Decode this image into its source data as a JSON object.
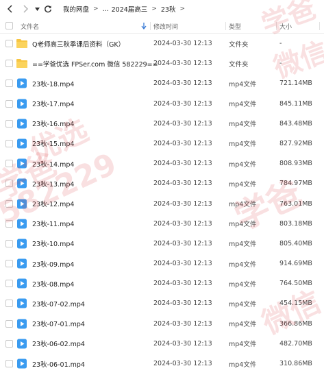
{
  "nav": {
    "breadcrumb": [
      "我的网盘",
      "...",
      "2024届高三",
      "23秋"
    ]
  },
  "header": {
    "name": "文件名",
    "date": "修改时间",
    "type": "类型",
    "size": "大小"
  },
  "files": [
    {
      "icon": "folder-icon",
      "name": "Q老师高三秋季课后资料（GK）",
      "date": "2024-03-30 12:13",
      "type": "文件夹",
      "size": "-"
    },
    {
      "icon": "folder-icon",
      "name": "==学爸优选 FPSer.com 微信 582229==",
      "date": "2024-03-30 12:13",
      "type": "文件夹",
      "size": "-"
    },
    {
      "icon": "video-icon",
      "name": "23秋-18.mp4",
      "date": "2024-03-30 12:13",
      "type": "mp4文件",
      "size": "721.14MB"
    },
    {
      "icon": "video-icon",
      "name": "23秋-17.mp4",
      "date": "2024-03-30 12:13",
      "type": "mp4文件",
      "size": "845.11MB"
    },
    {
      "icon": "video-icon",
      "name": "23秋-16.mp4",
      "date": "2024-03-30 12:13",
      "type": "mp4文件",
      "size": "843.48MB"
    },
    {
      "icon": "video-icon",
      "name": "23秋-15.mp4",
      "date": "2024-03-30 12:13",
      "type": "mp4文件",
      "size": "827.92MB"
    },
    {
      "icon": "video-icon",
      "name": "23秋-14.mp4",
      "date": "2024-03-30 12:13",
      "type": "mp4文件",
      "size": "808.93MB"
    },
    {
      "icon": "video-icon",
      "name": "23秋-13.mp4",
      "date": "2024-03-30 12:13",
      "type": "mp4文件",
      "size": "784.97MB"
    },
    {
      "icon": "video-icon",
      "name": "23秋-12.mp4",
      "date": "2024-03-30 12:13",
      "type": "mp4文件",
      "size": "763.01MB"
    },
    {
      "icon": "video-icon",
      "name": "23秋-11.mp4",
      "date": "2024-03-30 12:13",
      "type": "mp4文件",
      "size": "803.18MB"
    },
    {
      "icon": "video-icon",
      "name": "23秋-10.mp4",
      "date": "2024-03-30 12:13",
      "type": "mp4文件",
      "size": "805.40MB"
    },
    {
      "icon": "video-icon",
      "name": "23秋-09.mp4",
      "date": "2024-03-30 12:13",
      "type": "mp4文件",
      "size": "914.69MB"
    },
    {
      "icon": "video-icon",
      "name": "23秋-08.mp4",
      "date": "2024-03-30 12:13",
      "type": "mp4文件",
      "size": "764.50MB"
    },
    {
      "icon": "video-icon",
      "name": "23秋-07-02.mp4",
      "date": "2024-03-30 12:13",
      "type": "mp4文件",
      "size": "454.15MB"
    },
    {
      "icon": "video-icon",
      "name": "23秋-07-01.mp4",
      "date": "2024-03-30 12:13",
      "type": "mp4文件",
      "size": "366.86MB"
    },
    {
      "icon": "video-icon",
      "name": "23秋-06-02.mp4",
      "date": "2024-03-30 12:13",
      "type": "mp4文件",
      "size": "482.70MB"
    },
    {
      "icon": "video-icon",
      "name": "23秋-06-01.mp4",
      "date": "2024-03-30 12:13",
      "type": "mp4文件",
      "size": "310.86MB"
    }
  ],
  "watermarks": [
    "学爸",
    "微信",
    "学爸",
    "优选",
    "582229",
    "微信",
    "学爸"
  ],
  "colors": {
    "folder": "#f7c542",
    "video": "#3a9bf0",
    "watermark": "#dc3c46"
  }
}
